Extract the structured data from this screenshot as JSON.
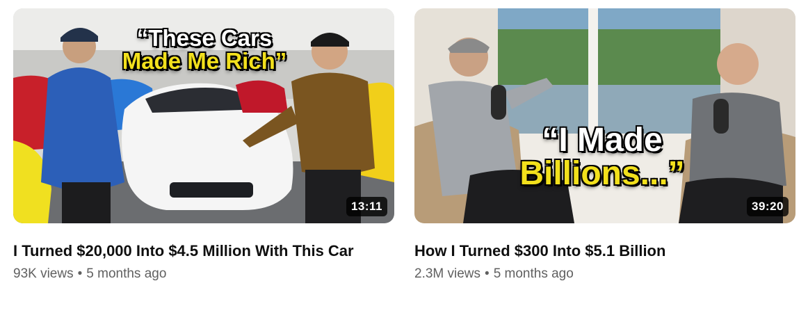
{
  "videos": [
    {
      "overlay_line1": "“These Cars",
      "overlay_line2": "Made Me Rich”",
      "duration": "13:11",
      "title": "I Turned $20,000 Into $4.5 Million With This Car",
      "views": "93K views",
      "separator": "•",
      "age": "5 months ago"
    },
    {
      "overlay_line1": "“I Made",
      "overlay_line2": "Billions...”",
      "duration": "39:20",
      "title": "How I Turned $300 Into $5.1 Billion",
      "views": "2.3M views",
      "separator": "•",
      "age": "5 months ago"
    }
  ],
  "colors": {
    "overlay_yellow": "#f2e01c",
    "title": "#0f0f0f",
    "meta": "#606060"
  }
}
